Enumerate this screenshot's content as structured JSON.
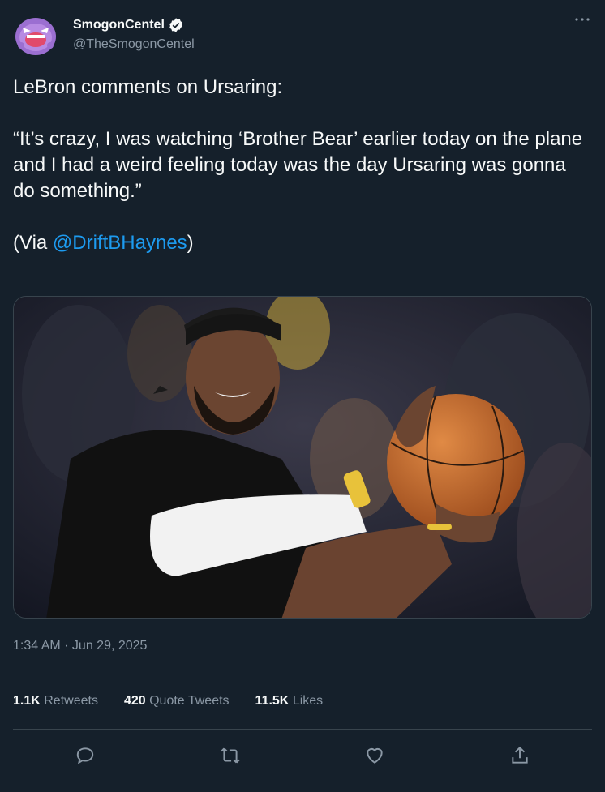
{
  "author": {
    "display_name": "SmogonCentel",
    "handle": "@TheSmogonCentel",
    "verified": true
  },
  "tweet": {
    "line1": "LeBron comments on Ursaring:",
    "quote": "“It’s crazy, I was watching ‘Brother Bear’ earlier today on the plane and I had a weird feeling today was the day Ursaring was gonna do something.”",
    "via_prefix": "(Via ",
    "via_mention": "@DriftBHaynes",
    "via_suffix": ")",
    "timestamp": "1:34 AM · Jun 29, 2025"
  },
  "stats": {
    "retweets_count": "1.1K",
    "retweets_label": "Retweets",
    "quotes_count": "420",
    "quotes_label": "Quote Tweets",
    "likes_count": "11.5K",
    "likes_label": "Likes"
  },
  "icons": {
    "more": "more-icon",
    "reply": "reply-icon",
    "retweet": "retweet-icon",
    "like": "like-icon",
    "share": "share-icon",
    "verified": "verified-badge-icon"
  },
  "colors": {
    "background": "#15202b",
    "text": "#f7f9f9",
    "muted": "#8b98a5",
    "link": "#1d9bf0",
    "divider": "#38444d"
  }
}
